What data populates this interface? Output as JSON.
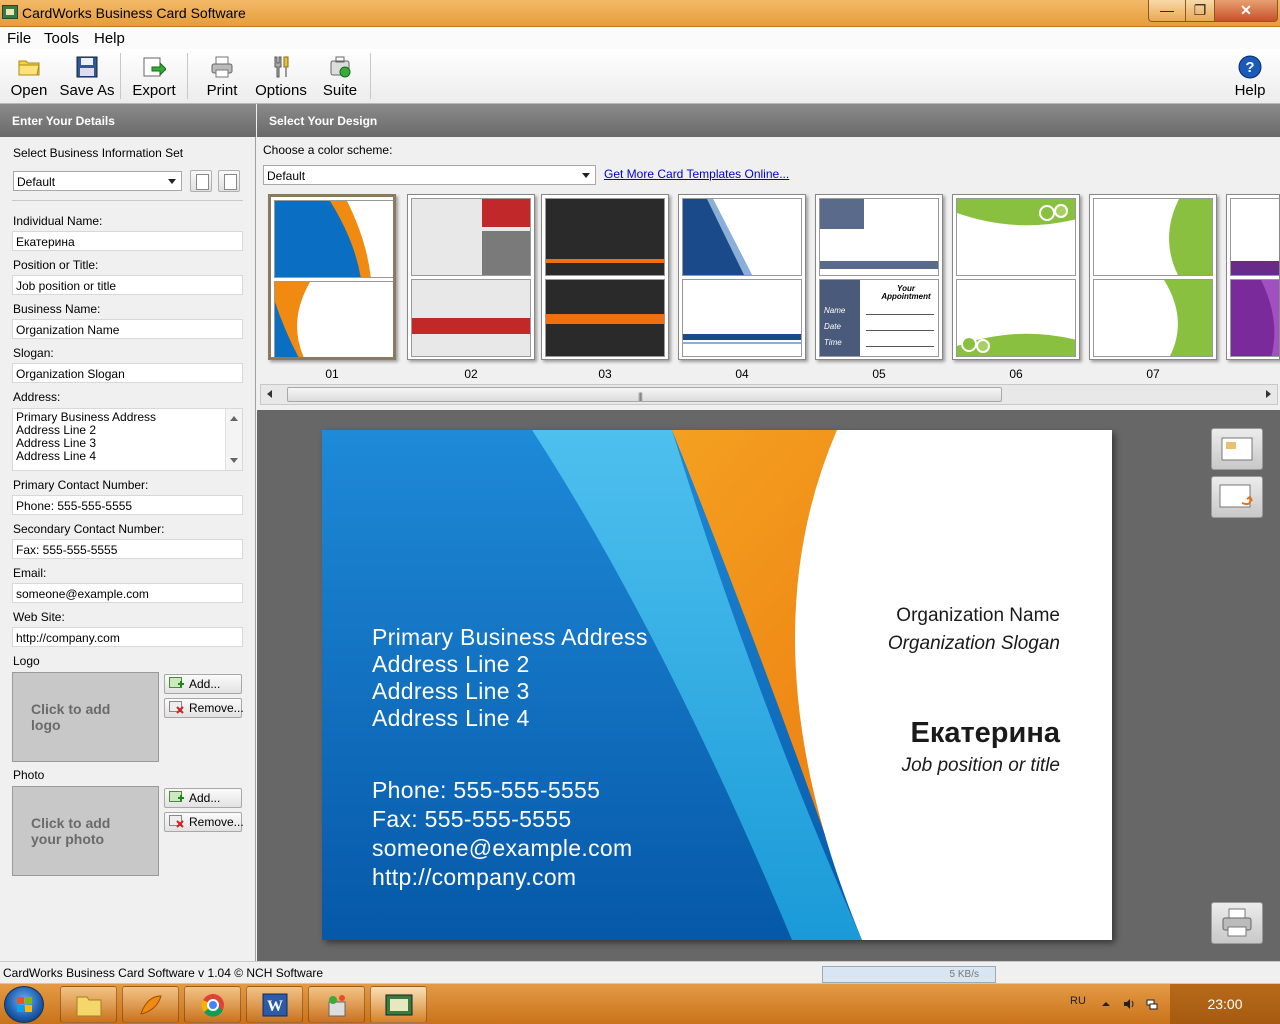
{
  "window": {
    "title": "CardWorks Business Card Software",
    "minimize": "—",
    "maximize": "❐",
    "close": "✕"
  },
  "menu": [
    "File",
    "Tools",
    "Help"
  ],
  "toolbar": {
    "open": "Open",
    "save_as": "Save As",
    "export": "Export",
    "print": "Print",
    "options": "Options",
    "suite": "Suite",
    "help": "Help"
  },
  "left": {
    "header": "Enter Your Details",
    "info_set_label": "Select Business Information Set",
    "info_set_value": "Default",
    "individual_name_label": "Individual Name:",
    "individual_name": "Екатерина",
    "position_label": "Position or Title:",
    "position": "Job position or title",
    "business_name_label": "Business Name:",
    "business_name": "Organization Name",
    "slogan_label": "Slogan:",
    "slogan": "Organization Slogan",
    "address_label": "Address:",
    "address_lines": [
      "Primary Business Address",
      "Address Line 2",
      "Address Line 3",
      "Address Line 4"
    ],
    "primary_contact_label": "Primary Contact Number:",
    "primary_contact": "Phone: 555-555-5555",
    "secondary_contact_label": "Secondary Contact Number:",
    "secondary_contact": "Fax: 555-555-5555",
    "email_label": "Email:",
    "email": "someone@example.com",
    "website_label": "Web Site:",
    "website": "http://company.com",
    "logo_label": "Logo",
    "logo_placeholder": "Click to add logo",
    "photo_label": "Photo",
    "photo_placeholder": "Click to add your photo",
    "add_button": "Add...",
    "remove_button": "Remove..."
  },
  "right": {
    "header": "Select Your Design",
    "color_scheme_label": "Choose a color scheme:",
    "color_scheme_value": "Default",
    "templates_link": "Get More Card Templates Online...",
    "thumbnails": [
      "01",
      "02",
      "03",
      "04",
      "05",
      "06",
      "07"
    ]
  },
  "card": {
    "address_lines": [
      "Primary Business Address",
      "Address Line 2",
      "Address Line 3",
      "Address Line 4"
    ],
    "phone": "Phone: 555-555-5555",
    "fax": "Fax: 555-555-5555",
    "email": "someone@example.com",
    "website": "http://company.com",
    "org_name": "Organization Name",
    "org_slogan": "Organization Slogan",
    "person_name": "Екатерина",
    "person_title": "Job position or title"
  },
  "thumb_05_back": {
    "heading": "Your Appointment",
    "fields": [
      "Name",
      "Date",
      "Time"
    ]
  },
  "status": {
    "text": "CardWorks Business Card Software v 1.04 © NCH Software",
    "net_speed": "5 KB/s"
  },
  "taskbar": {
    "language": "RU",
    "clock": "23:00"
  },
  "colors": {
    "titlebar": "#e69d3a",
    "card_blue": "#0a6fc2",
    "card_orange": "#f08a10",
    "card_light_blue": "#4ab8e8",
    "link": "#0000cc"
  }
}
